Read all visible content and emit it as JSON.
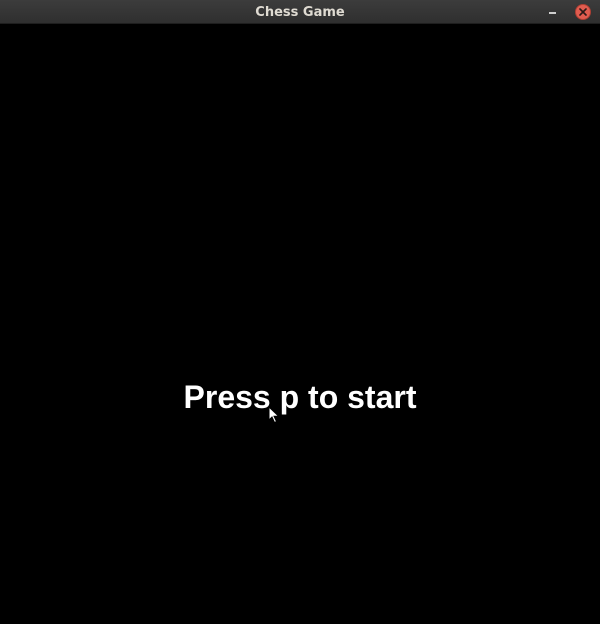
{
  "window": {
    "title": "Chess Game",
    "controls": {
      "minimize_icon": "minimize-icon",
      "close_icon": "close-icon",
      "close_color": "#e05c4f"
    }
  },
  "game": {
    "background_color": "#000000",
    "text_color": "#ffffff",
    "start_message": "Press p to start"
  },
  "pointer": {
    "icon": "mouse-pointer-icon"
  }
}
